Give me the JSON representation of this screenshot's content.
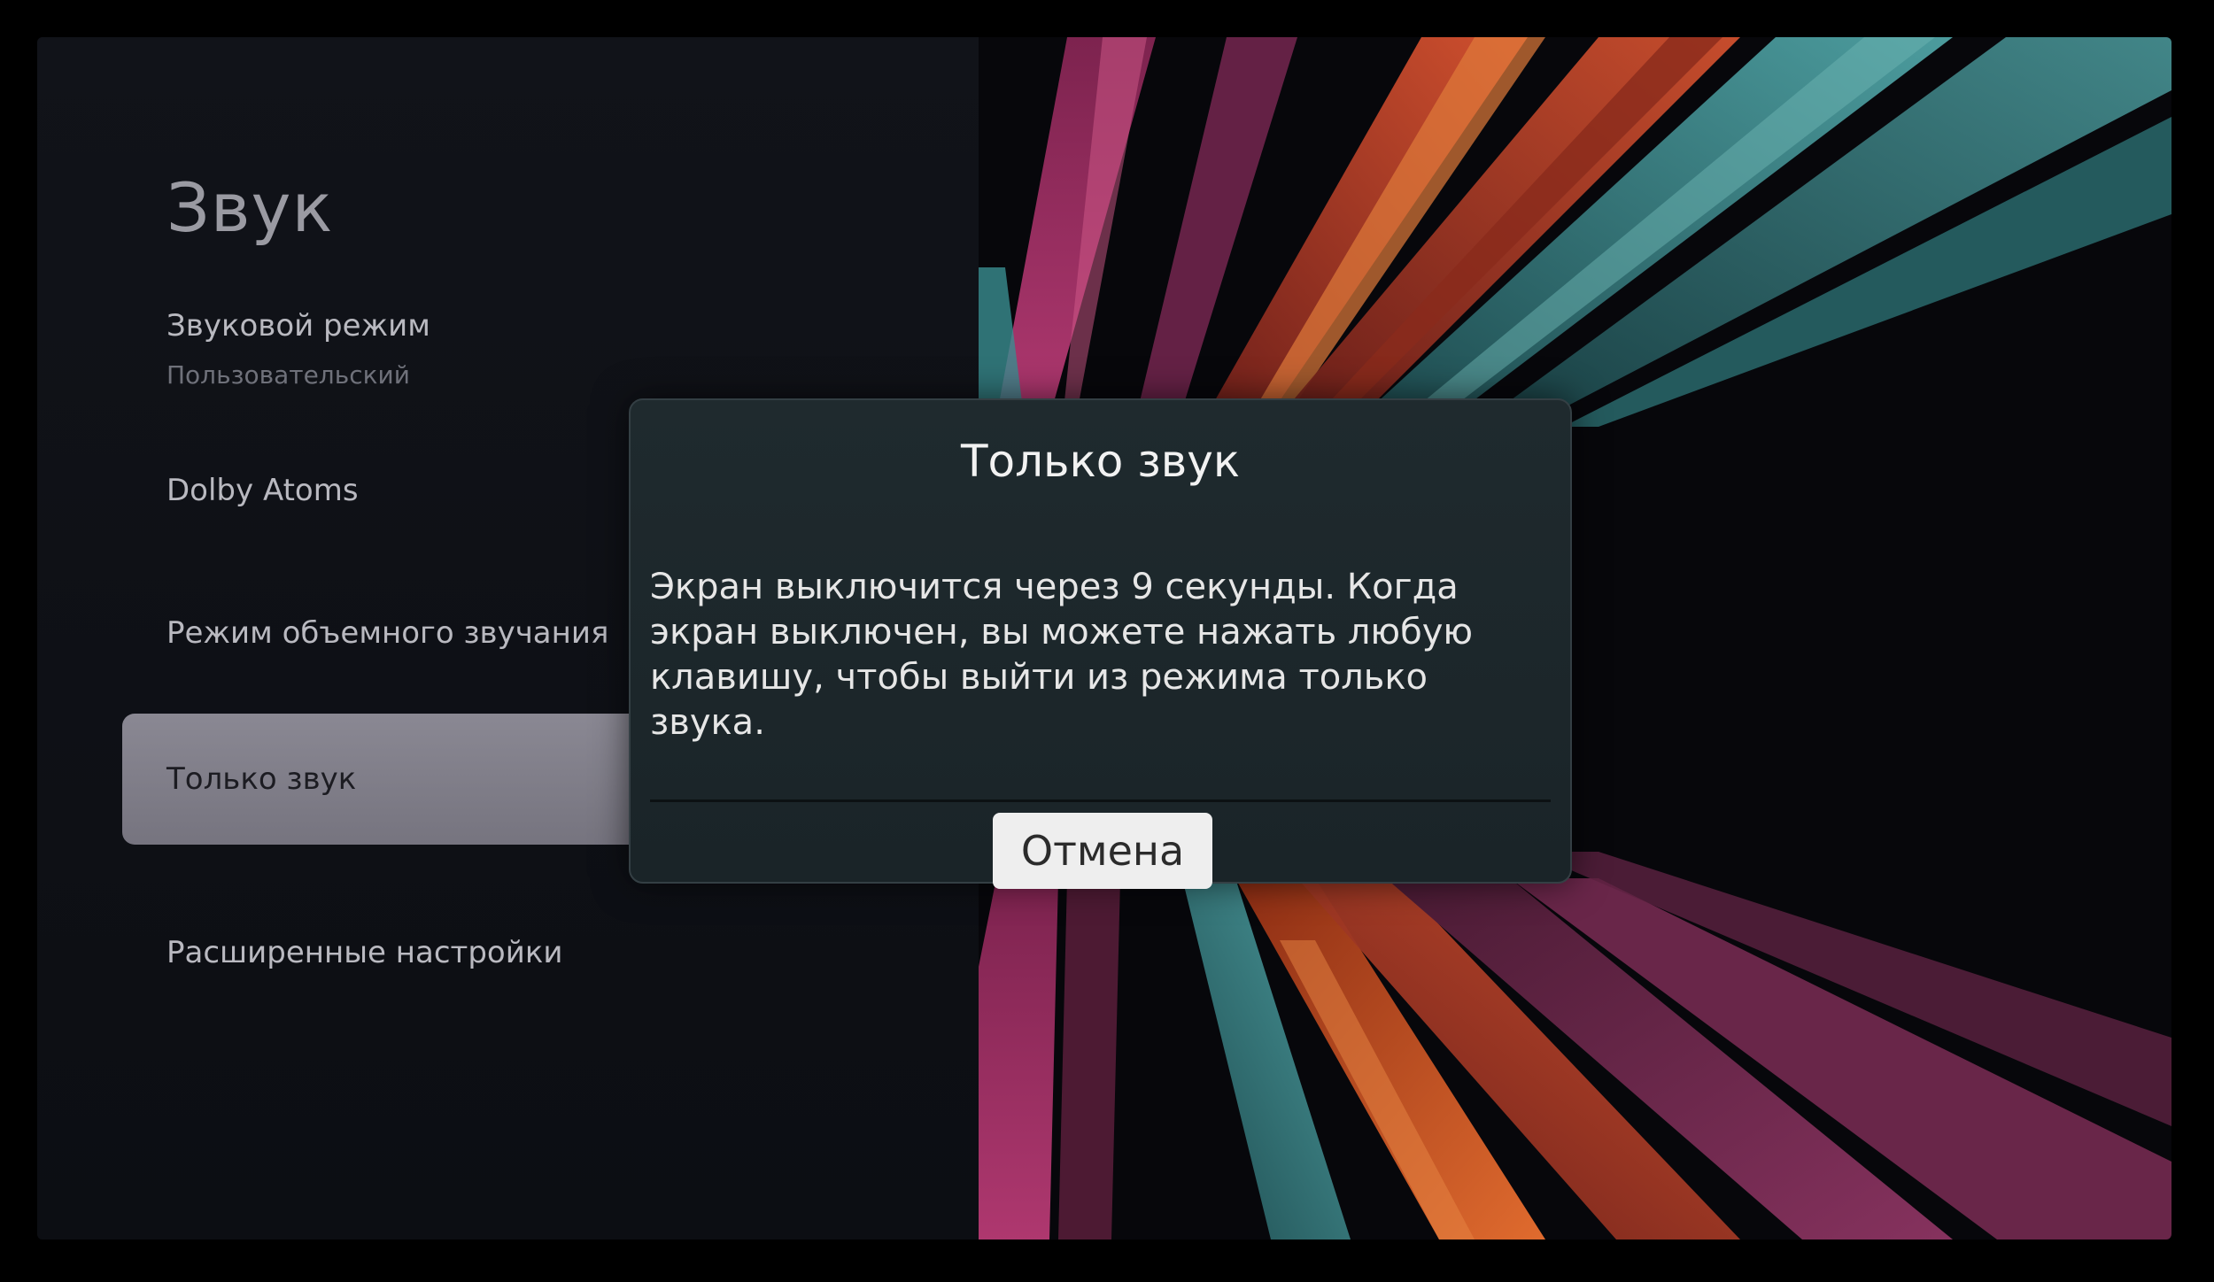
{
  "settings": {
    "title": "Звук",
    "items": [
      {
        "label": "Звуковой режим",
        "value": "Пользовательский"
      },
      {
        "label": "Dolby Atoms"
      },
      {
        "label": "Режим объемного звучания"
      },
      {
        "label": "Только звук",
        "focused": true
      },
      {
        "label": "Расширенные настройки"
      }
    ]
  },
  "dialog": {
    "title": "Только звук",
    "message": "Экран выключится через 9 секунды. Когда экран выключен, вы можете нажать любую клавишу, чтобы выйти из режима только звука.",
    "cancel_label": "Отмена"
  },
  "colors": {
    "dialog_bg": "#1f2a2e",
    "focus_bg": "#8a8893",
    "stripe_red": "#c0402a",
    "stripe_teal": "#3e8a8c",
    "stripe_magenta": "#a8336e",
    "stripe_orange": "#d8652a"
  }
}
